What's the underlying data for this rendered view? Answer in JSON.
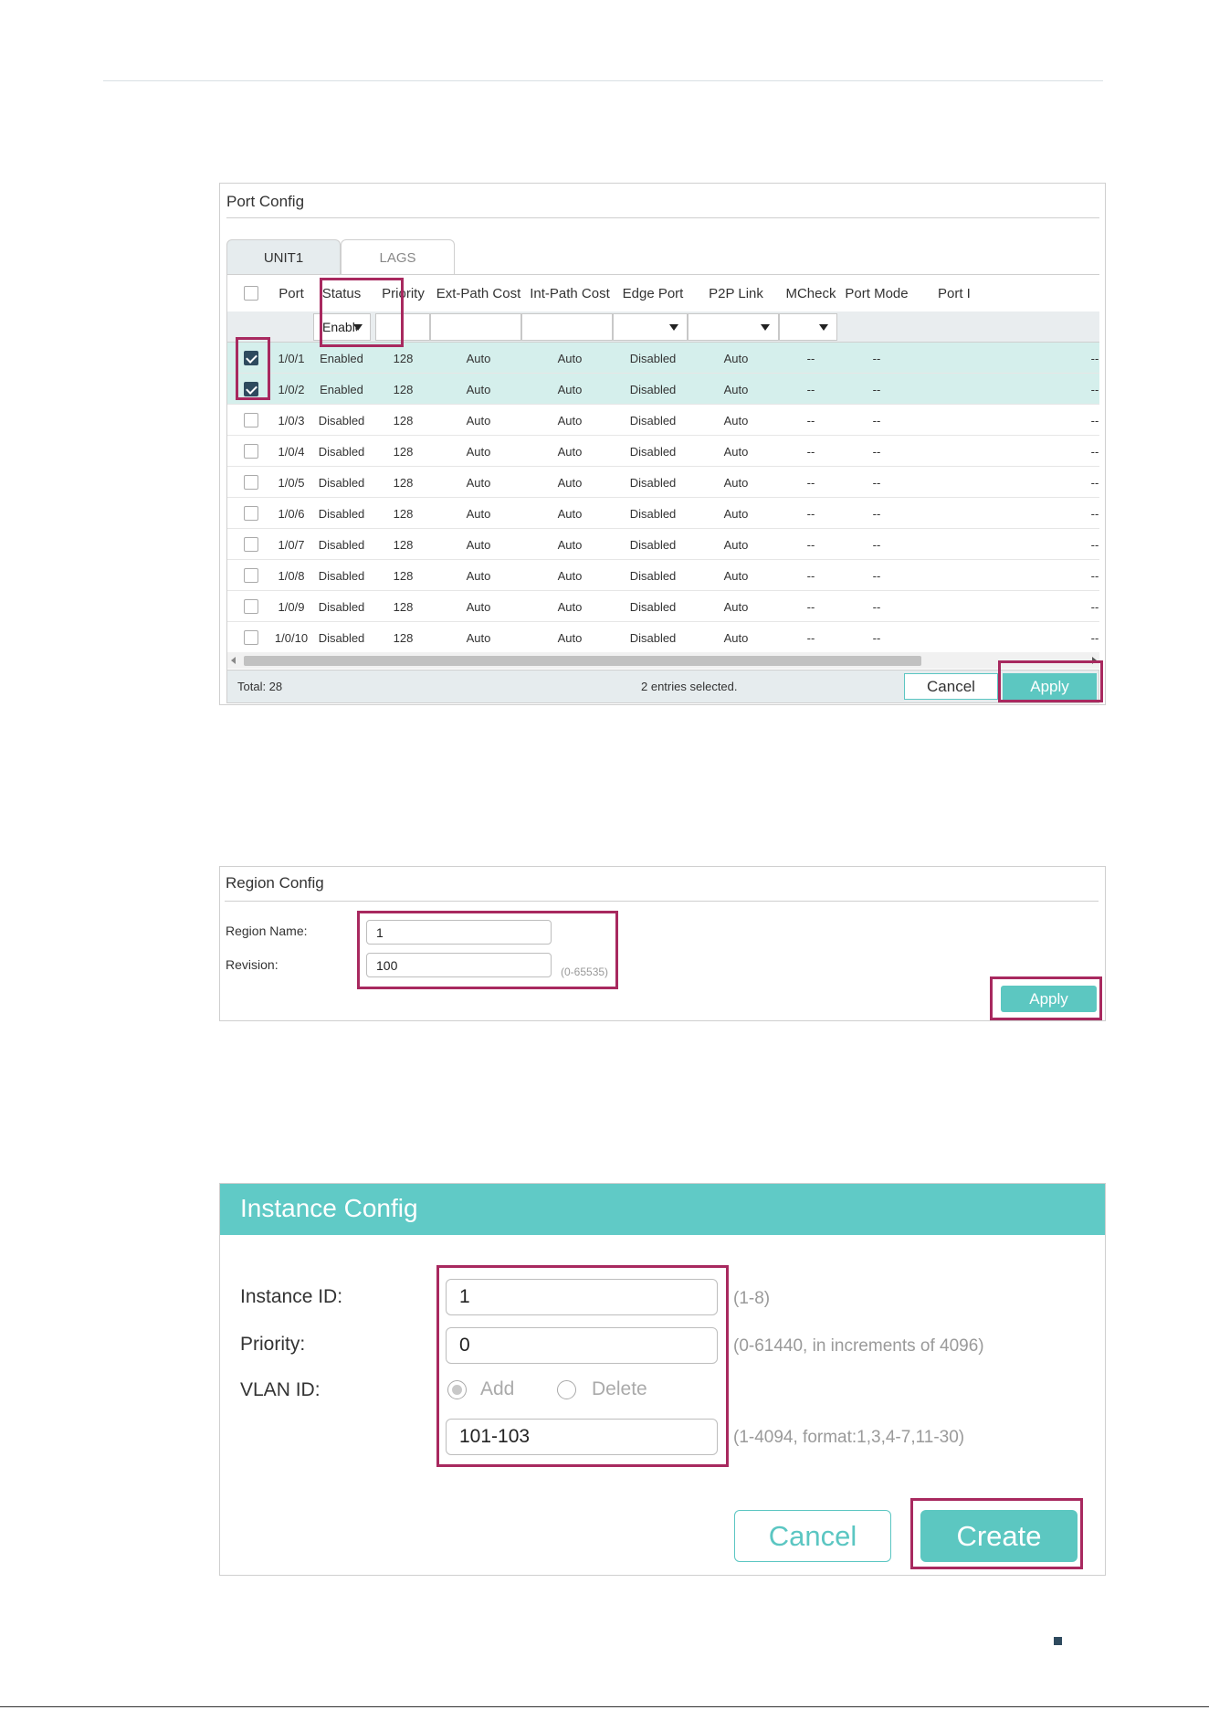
{
  "port_config": {
    "title": "Port Config",
    "tabs": [
      {
        "label": "UNIT1",
        "active": true
      },
      {
        "label": "LAGS",
        "active": false
      }
    ],
    "columns": [
      "Port",
      "Status",
      "Priority",
      "Ext-Path Cost",
      "Int-Path Cost",
      "Edge Port",
      "P2P Link",
      "MCheck",
      "Port Mode",
      "Port I"
    ],
    "filter": {
      "status_value": "Enable"
    },
    "rows": [
      {
        "checked": true,
        "port": "1/0/1",
        "status": "Enabled",
        "priority": "128",
        "ext_path_cost": "Auto",
        "int_path_cost": "Auto",
        "edge_port": "Disabled",
        "p2p_link": "Auto",
        "mcheck": "--",
        "port_mode": "--",
        "port_i": "--"
      },
      {
        "checked": true,
        "port": "1/0/2",
        "status": "Enabled",
        "priority": "128",
        "ext_path_cost": "Auto",
        "int_path_cost": "Auto",
        "edge_port": "Disabled",
        "p2p_link": "Auto",
        "mcheck": "--",
        "port_mode": "--",
        "port_i": "--"
      },
      {
        "checked": false,
        "port": "1/0/3",
        "status": "Disabled",
        "priority": "128",
        "ext_path_cost": "Auto",
        "int_path_cost": "Auto",
        "edge_port": "Disabled",
        "p2p_link": "Auto",
        "mcheck": "--",
        "port_mode": "--",
        "port_i": "--"
      },
      {
        "checked": false,
        "port": "1/0/4",
        "status": "Disabled",
        "priority": "128",
        "ext_path_cost": "Auto",
        "int_path_cost": "Auto",
        "edge_port": "Disabled",
        "p2p_link": "Auto",
        "mcheck": "--",
        "port_mode": "--",
        "port_i": "--"
      },
      {
        "checked": false,
        "port": "1/0/5",
        "status": "Disabled",
        "priority": "128",
        "ext_path_cost": "Auto",
        "int_path_cost": "Auto",
        "edge_port": "Disabled",
        "p2p_link": "Auto",
        "mcheck": "--",
        "port_mode": "--",
        "port_i": "--"
      },
      {
        "checked": false,
        "port": "1/0/6",
        "status": "Disabled",
        "priority": "128",
        "ext_path_cost": "Auto",
        "int_path_cost": "Auto",
        "edge_port": "Disabled",
        "p2p_link": "Auto",
        "mcheck": "--",
        "port_mode": "--",
        "port_i": "--"
      },
      {
        "checked": false,
        "port": "1/0/7",
        "status": "Disabled",
        "priority": "128",
        "ext_path_cost": "Auto",
        "int_path_cost": "Auto",
        "edge_port": "Disabled",
        "p2p_link": "Auto",
        "mcheck": "--",
        "port_mode": "--",
        "port_i": "--"
      },
      {
        "checked": false,
        "port": "1/0/8",
        "status": "Disabled",
        "priority": "128",
        "ext_path_cost": "Auto",
        "int_path_cost": "Auto",
        "edge_port": "Disabled",
        "p2p_link": "Auto",
        "mcheck": "--",
        "port_mode": "--",
        "port_i": "--"
      },
      {
        "checked": false,
        "port": "1/0/9",
        "status": "Disabled",
        "priority": "128",
        "ext_path_cost": "Auto",
        "int_path_cost": "Auto",
        "edge_port": "Disabled",
        "p2p_link": "Auto",
        "mcheck": "--",
        "port_mode": "--",
        "port_i": "--"
      },
      {
        "checked": false,
        "port": "1/0/10",
        "status": "Disabled",
        "priority": "128",
        "ext_path_cost": "Auto",
        "int_path_cost": "Auto",
        "edge_port": "Disabled",
        "p2p_link": "Auto",
        "mcheck": "--",
        "port_mode": "--",
        "port_i": "--"
      }
    ],
    "footer": {
      "total": "Total: 28",
      "selected": "2 entries selected.",
      "cancel_label": "Cancel",
      "apply_label": "Apply"
    }
  },
  "region_config": {
    "title": "Region Config",
    "region_name_label": "Region Name:",
    "region_name_value": "1",
    "revision_label": "Revision:",
    "revision_value": "100",
    "revision_hint": "(0-65535)",
    "apply_label": "Apply"
  },
  "instance_config": {
    "title": "Instance Config",
    "instance_id_label": "Instance ID:",
    "instance_id_value": "1",
    "instance_id_hint": "(1-8)",
    "priority_label": "Priority:",
    "priority_value": "0",
    "priority_hint": "(0-61440, in increments of 4096)",
    "vlan_id_label": "VLAN ID:",
    "vlan_add_label": "Add",
    "vlan_delete_label": "Delete",
    "vlan_selected": "Add",
    "vlan_id_value": "101-103",
    "vlan_id_hint": "(1-4094, format:1,3,4-7,11-30)",
    "cancel_label": "Cancel",
    "create_label": "Create"
  },
  "colors": {
    "accent": "#5cc7c1",
    "highlight": "#a8295f",
    "selected_row": "#d5efec",
    "checkbox_checked": "#2e4a5e"
  }
}
